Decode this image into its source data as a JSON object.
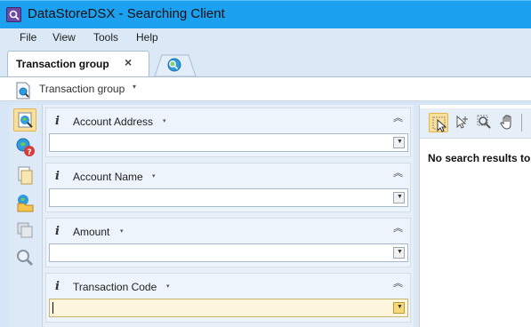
{
  "window": {
    "title": "DataStoreDSX - Searching Client",
    "app_icon": "datastore-app-icon"
  },
  "menu": [
    {
      "label": "File"
    },
    {
      "label": "View"
    },
    {
      "label": "Tools"
    },
    {
      "label": "Help"
    }
  ],
  "tabs": {
    "active": {
      "label": "Transaction group",
      "close": "×"
    },
    "secondary": {
      "icon": "search-globe-icon"
    }
  },
  "toolbar": {
    "label": "Transaction group",
    "caret": "▾"
  },
  "sidebar": {
    "buttons": [
      "search-criteria-icon",
      "help-query-icon",
      "documents-icon",
      "open-folder-icon",
      "copy-icon",
      "magnifier-icon"
    ],
    "selected": "search-criteria-icon"
  },
  "fields": [
    {
      "label": "Account Address",
      "info": "i",
      "caret": "▾",
      "collapse": "⌃⌃",
      "value": ""
    },
    {
      "label": "Account Name",
      "info": "i",
      "caret": "▾",
      "collapse": "⌃⌃",
      "value": ""
    },
    {
      "label": "Amount",
      "info": "i",
      "caret": "▾",
      "collapse": "⌃⌃",
      "value": ""
    },
    {
      "label": "Transaction Code",
      "info": "i",
      "caret": "▾",
      "collapse": "⌃⌃",
      "value": "",
      "focused": true
    }
  ],
  "results": {
    "tools": [
      "select-pointer-icon",
      "add-pointer-icon",
      "zoom-region-icon",
      "pan-hand-icon"
    ],
    "message": "No search results to d"
  },
  "colors": {
    "title_bar": "#1ca0f0",
    "selected": "#fbe09a",
    "panel": "#e6eef8"
  }
}
